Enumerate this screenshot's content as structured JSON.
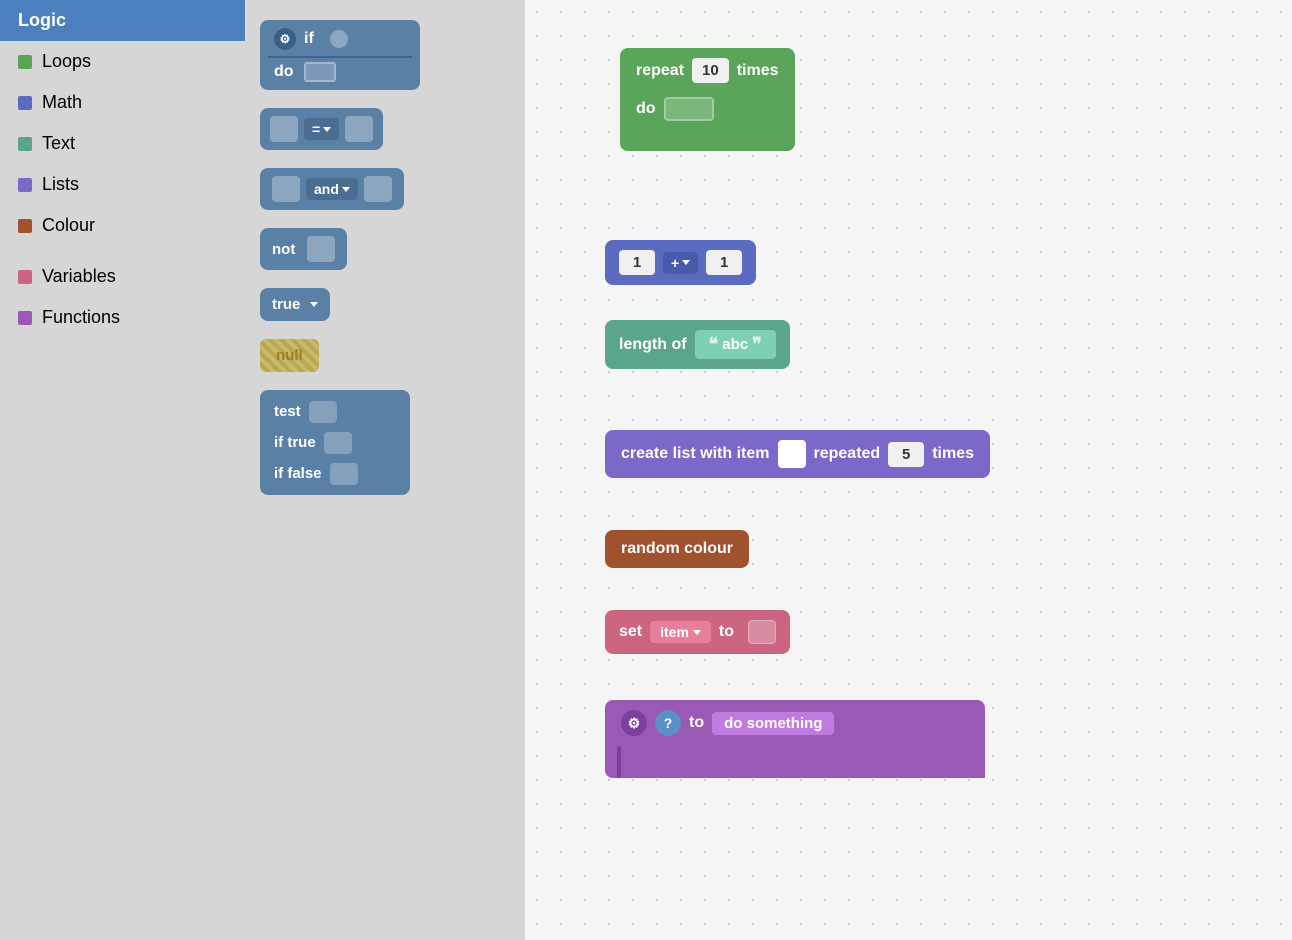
{
  "sidebar": {
    "items": [
      {
        "id": "logic",
        "label": "Logic",
        "color": "#4c7fbe",
        "active": true
      },
      {
        "id": "loops",
        "label": "Loops",
        "color": "#5ba55b"
      },
      {
        "id": "math",
        "label": "Math",
        "color": "#5b6bbf"
      },
      {
        "id": "text",
        "label": "Text",
        "color": "#5ba58a"
      },
      {
        "id": "lists",
        "label": "Lists",
        "color": "#7b68c8"
      },
      {
        "id": "colour",
        "label": "Colour",
        "color": "#a0522d"
      },
      {
        "id": "variables",
        "label": "Variables",
        "color": "#cc6680"
      },
      {
        "id": "functions",
        "label": "Functions",
        "color": "#9b59b6"
      }
    ]
  },
  "blocks_panel": {
    "if_block": {
      "label_if": "if",
      "label_do": "do"
    },
    "equals_block": {
      "operator": "="
    },
    "and_block": {
      "operator": "and"
    },
    "not_block": {
      "label": "not"
    },
    "true_block": {
      "label": "true"
    },
    "null_block": {
      "label": "null"
    },
    "ternary_block": {
      "label_test": "test",
      "label_if_true": "if true",
      "label_if_false": "if false"
    }
  },
  "canvas": {
    "repeat_block": {
      "label_repeat": "repeat",
      "value": "10",
      "label_times": "times",
      "label_do": "do"
    },
    "math_block": {
      "val1": "1",
      "operator": "+",
      "val2": "1"
    },
    "textlen_block": {
      "label": "length of",
      "value": "abc"
    },
    "list_block": {
      "label_create": "create list with item",
      "label_repeated": "repeated",
      "times_value": "5",
      "label_times": "times"
    },
    "colour_block": {
      "label": "random colour"
    },
    "vars_block": {
      "label_set": "set",
      "var_name": "item",
      "label_to": "to"
    },
    "func_block": {
      "label_to": "to",
      "func_name": "do something"
    }
  },
  "icons": {
    "gear": "⚙",
    "question": "?",
    "arrow_down": "▾"
  }
}
